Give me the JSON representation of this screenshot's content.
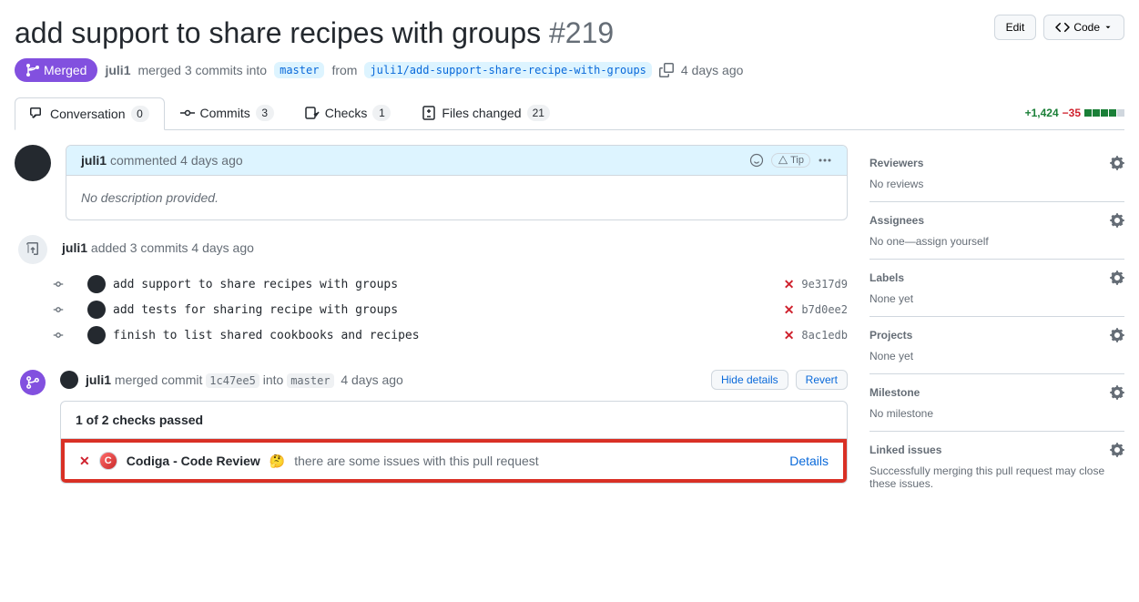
{
  "pr": {
    "title": "add support to share recipes with groups",
    "number": "#219",
    "state": "Merged",
    "author": "juli1",
    "meta_merged": " merged 3 commits into ",
    "base_branch": "master",
    "meta_from": " from ",
    "head_branch": "juli1/add-support-share-recipe-with-groups",
    "timestamp": "4 days ago"
  },
  "header_actions": {
    "edit": "Edit",
    "code": "Code"
  },
  "tabs": {
    "conversation": {
      "label": "Conversation",
      "count": "0"
    },
    "commits": {
      "label": "Commits",
      "count": "3"
    },
    "checks": {
      "label": "Checks",
      "count": "1"
    },
    "files": {
      "label": "Files changed",
      "count": "21"
    }
  },
  "diffstat": {
    "additions": "+1,424",
    "deletions": "−35"
  },
  "comment": {
    "author": "juli1",
    "action": " commented ",
    "time": "4 days ago",
    "body": "No description provided.",
    "tip": "Tip"
  },
  "commits_event": {
    "author": "juli1",
    "action": " added 3 commits ",
    "time": "4 days ago"
  },
  "commits": [
    {
      "msg": "add support to share recipes with groups",
      "sha": "9e317d9"
    },
    {
      "msg": "add tests for sharing recipe with groups",
      "sha": "b7d0ee2"
    },
    {
      "msg": "finish to list shared cookbooks and recipes",
      "sha": "8ac1edb"
    }
  ],
  "merge_event": {
    "author": "juli1",
    "action": " merged commit ",
    "sha": "1c47ee5",
    "into": " into ",
    "branch": "master",
    "time": "4 days ago",
    "hide_details": "Hide details",
    "revert": "Revert"
  },
  "checks": {
    "summary": "1 of 2 checks passed",
    "codiga_name": "Codiga - Code Review",
    "codiga_msg": "there are some issues with this pull request",
    "details": "Details"
  },
  "sidebar": {
    "reviewers": {
      "title": "Reviewers",
      "value": "No reviews"
    },
    "assignees": {
      "title": "Assignees",
      "value": "No one—assign yourself"
    },
    "labels": {
      "title": "Labels",
      "value": "None yet"
    },
    "projects": {
      "title": "Projects",
      "value": "None yet"
    },
    "milestone": {
      "title": "Milestone",
      "value": "No milestone"
    },
    "linked": {
      "title": "Linked issues",
      "value": "Successfully merging this pull request may close these issues."
    }
  }
}
